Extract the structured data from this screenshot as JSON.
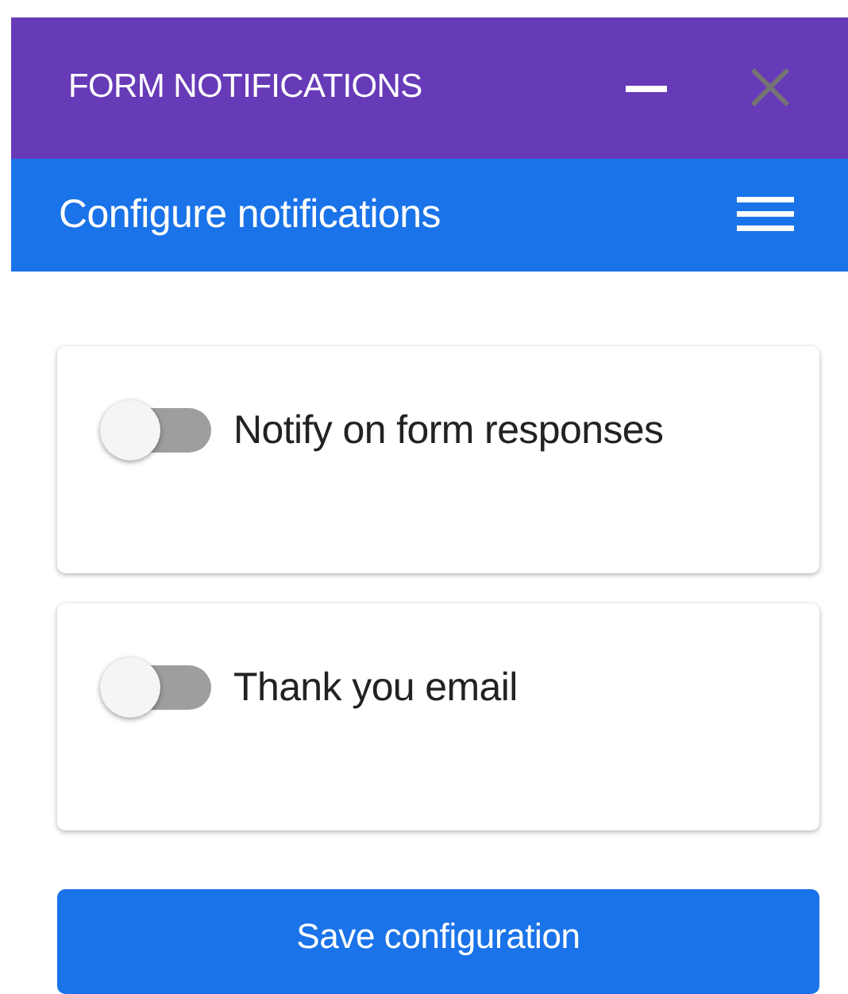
{
  "window": {
    "title": "FORM NOTIFICATIONS",
    "close_disabled": true
  },
  "header": {
    "title": "Configure notifications"
  },
  "settings": [
    {
      "label": "Notify on form responses",
      "on": false
    },
    {
      "label": "Thank you email",
      "on": false
    }
  ],
  "save_button": "Save configuration"
}
